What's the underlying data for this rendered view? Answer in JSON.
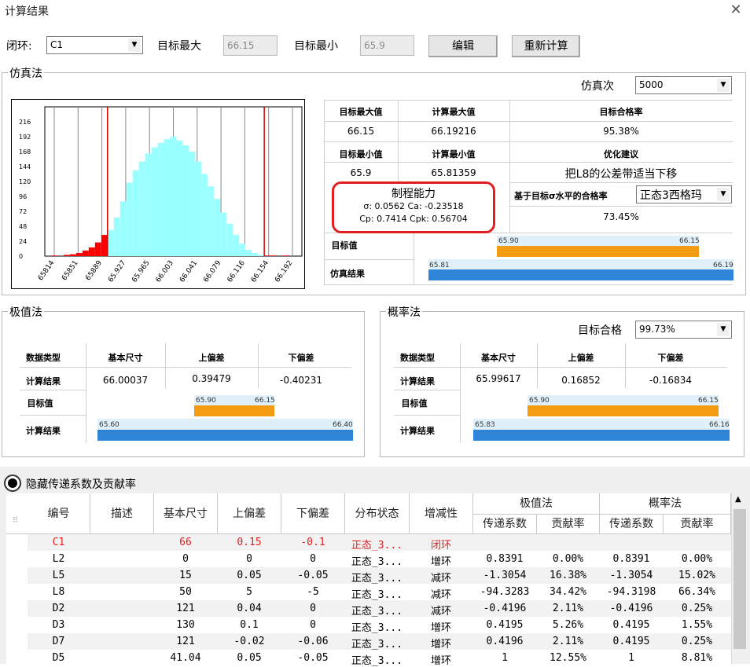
{
  "window": {
    "title": "计算结果"
  },
  "top": {
    "loop_label": "闭环:",
    "loop_value": "C1",
    "target_max_label": "目标最大",
    "target_max_value": "66.15",
    "target_min_label": "目标最小",
    "target_min_value": "65.9",
    "edit_button": "编辑",
    "recalc_button": "重新计算"
  },
  "sim": {
    "group_title": "仿真法",
    "count_label": "仿真次",
    "count_value": "5000",
    "hdr_target_max": "目标最大值",
    "hdr_calc_max": "计算最大值",
    "hdr_target_yield": "目标合格率",
    "val_target_max": "66.15",
    "val_calc_max": "66.19216",
    "val_target_yield": "95.38%",
    "hdr_target_min": "目标最小值",
    "hdr_calc_min": "计算最小值",
    "hdr_suggest": "优化建议",
    "val_target_min": "65.9",
    "val_calc_min": "65.81359",
    "val_suggest": "把L8的公差带适当下移",
    "cap_title": "制程能力",
    "cap_line1": "σ: 0.0562 Ca: -0.23518",
    "cap_line2": "Cp: 0.7414 Cpk: 0.56704",
    "sigma_label": "基于目标σ水平的合格率",
    "sigma_value": "正态3西格玛",
    "sigma_yield": "73.45%",
    "row_target": "目标值",
    "row_result": "仿真结果",
    "bar_target_lo": "65.90",
    "bar_target_hi": "66.15",
    "bar_result_lo": "65.81",
    "bar_result_hi": "66.19"
  },
  "chart_data": {
    "type": "bar",
    "yticks": [
      0,
      24,
      48,
      72,
      96,
      120,
      144,
      168,
      192,
      216
    ],
    "xticks": [
      "65814",
      "65851",
      "65889",
      "65.927",
      "65.965",
      "66.003",
      "66.041",
      "66.079",
      "66.116",
      "66.154",
      "66.192"
    ],
    "xlim": [
      65.8,
      66.21
    ],
    "ylim": [
      0,
      240
    ],
    "spec_limits": [
      65.9,
      66.15
    ],
    "x": [
      65.815,
      65.825,
      65.835,
      65.845,
      65.855,
      65.865,
      65.875,
      65.885,
      65.895,
      65.905,
      65.915,
      65.925,
      65.935,
      65.945,
      65.955,
      65.965,
      65.975,
      65.985,
      65.995,
      66.005,
      66.015,
      66.025,
      66.035,
      66.045,
      66.055,
      66.065,
      66.075,
      66.085,
      66.095,
      66.105,
      66.115,
      66.125,
      66.135,
      66.145,
      66.155,
      66.165,
      66.175,
      66.185
    ],
    "values": [
      1,
      0,
      2,
      3,
      5,
      9,
      14,
      22,
      34,
      42,
      62,
      88,
      118,
      138,
      152,
      165,
      175,
      182,
      188,
      192,
      186,
      178,
      168,
      152,
      132,
      112,
      92,
      70,
      52,
      34,
      20,
      10,
      5,
      2,
      1,
      1,
      0,
      1
    ]
  },
  "extreme": {
    "group_title": "极值法",
    "hdr_type": "数据类型",
    "hdr_base": "基本尺寸",
    "hdr_upper": "上偏差",
    "hdr_lower": "下偏差",
    "row_label": "计算结果",
    "base": "66.00037",
    "upper": "0.39479",
    "lower": "-0.40231",
    "row_target": "目标值",
    "row_result": "计算结果",
    "bar_target_lo": "65.90",
    "bar_target_hi": "66.15",
    "bar_result_lo": "65.60",
    "bar_result_hi": "66.40"
  },
  "prob": {
    "group_title": "概率法",
    "yield_label": "目标合格",
    "yield_value": "99.73%",
    "hdr_type": "数据类型",
    "hdr_base": "基本尺寸",
    "hdr_upper": "上偏差",
    "hdr_lower": "下偏差",
    "row_label": "计算结果",
    "base": "65.99617",
    "upper": "0.16852",
    "lower": "-0.16834",
    "row_target": "目标值",
    "row_result": "计算结果",
    "bar_target_lo": "65.90",
    "bar_target_hi": "66.15",
    "bar_result_lo": "65.83",
    "bar_result_hi": "66.16"
  },
  "contrib": {
    "toggle_label": "隐藏传递系数及贡献率",
    "headers": {
      "id": "编号",
      "desc": "描述",
      "base": "基本尺寸",
      "upper": "上偏差",
      "lower": "下偏差",
      "dist": "分布状态",
      "inc": "增减性",
      "extreme": "极值法",
      "prob": "概率法",
      "coef1": "传递系数",
      "rate1": "贡献率",
      "coef2": "传递系数",
      "rate2": "贡献率"
    },
    "rows": [
      {
        "id": "C1",
        "desc": "",
        "base": "66",
        "upper": "0.15",
        "lower": "-0.1",
        "dist": "正态_3...",
        "inc": "闭环",
        "coef1": "",
        "rate1": "",
        "coef2": "",
        "rate2": ""
      },
      {
        "id": "L2",
        "desc": "",
        "base": "0",
        "upper": "0",
        "lower": "0",
        "dist": "正态_3...",
        "inc": "增环",
        "coef1": "0.8391",
        "rate1": "0.00%",
        "coef2": "0.8391",
        "rate2": "0.00%"
      },
      {
        "id": "L5",
        "desc": "",
        "base": "15",
        "upper": "0.05",
        "lower": "-0.05",
        "dist": "正态_3...",
        "inc": "减环",
        "coef1": "-1.3054",
        "rate1": "16.38%",
        "coef2": "-1.3054",
        "rate2": "15.02%"
      },
      {
        "id": "L8",
        "desc": "",
        "base": "50",
        "upper": "5",
        "lower": "-5",
        "dist": "正态_3...",
        "inc": "减环",
        "coef1": "-94.3283",
        "rate1": "34.42%",
        "coef2": "-94.3198",
        "rate2": "66.34%"
      },
      {
        "id": "D2",
        "desc": "",
        "base": "121",
        "upper": "0.04",
        "lower": "0",
        "dist": "正态_3...",
        "inc": "减环",
        "coef1": "-0.4196",
        "rate1": "2.11%",
        "coef2": "-0.4196",
        "rate2": "0.25%"
      },
      {
        "id": "D3",
        "desc": "",
        "base": "130",
        "upper": "0.1",
        "lower": "0",
        "dist": "正态_3...",
        "inc": "增环",
        "coef1": "0.4195",
        "rate1": "5.26%",
        "coef2": "0.4195",
        "rate2": "1.55%"
      },
      {
        "id": "D7",
        "desc": "",
        "base": "121",
        "upper": "-0.02",
        "lower": "-0.06",
        "dist": "正态_3...",
        "inc": "增环",
        "coef1": "0.4196",
        "rate1": "2.11%",
        "coef2": "0.4195",
        "rate2": "0.25%"
      },
      {
        "id": "D5",
        "desc": "",
        "base": "41.04",
        "upper": "0.05",
        "lower": "-0.05",
        "dist": "正态_3...",
        "inc": "增环",
        "coef1": "1",
        "rate1": "12.55%",
        "coef2": "1",
        "rate2": "8.81%"
      }
    ]
  },
  "colors": {
    "orange": "#f39c12",
    "blue": "#2f86d8",
    "cyan": "#99ffff",
    "red": "#ff0000"
  }
}
